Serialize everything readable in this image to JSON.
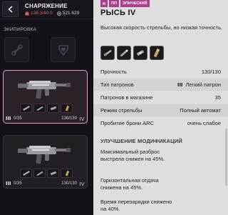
{
  "header": {
    "title": "СНАРЯЖЕНИЕ",
    "weight": "138.3/40.0",
    "money": "521 629"
  },
  "inventory": {
    "section_label": "ЭКИПИРОВКА",
    "cards": [
      {
        "ammo": "0/35",
        "durability": "130/130"
      },
      {
        "ammo": "0/35",
        "durability": "130/130"
      }
    ]
  },
  "item": {
    "tags": [
      "ПП",
      "ЭПИЧЕСКИЙ"
    ],
    "name": "РЫСЬ IV",
    "description": "Высокая скорость стрельбы, но низкая точность.",
    "stats": [
      {
        "label": "Прочность",
        "value": "130/130"
      },
      {
        "label": "Тип патронов",
        "value": "Легкий патрон",
        "icon": "ammo-icon"
      },
      {
        "label": "Патронов в магазине",
        "value": "35"
      },
      {
        "label": "Режим стрельбы",
        "value": "Полный автомат"
      },
      {
        "label": "Пробитие брони ARC",
        "value": "очень слабое"
      }
    ],
    "upgrades_title": "УЛУЧШЕНИЕ МОДИФИКАЦИЙ",
    "upgrades": [
      "Максимальный разброс выстрела снижен на 45%.",
      "Горизонтальная отдача снижена на 45%.",
      "Время перезарядки снижено на 40%."
    ]
  },
  "colors": {
    "accent_tag": "#b03d8c",
    "selected_border": "#d6a3c8",
    "weight_over": "#e0625a"
  }
}
